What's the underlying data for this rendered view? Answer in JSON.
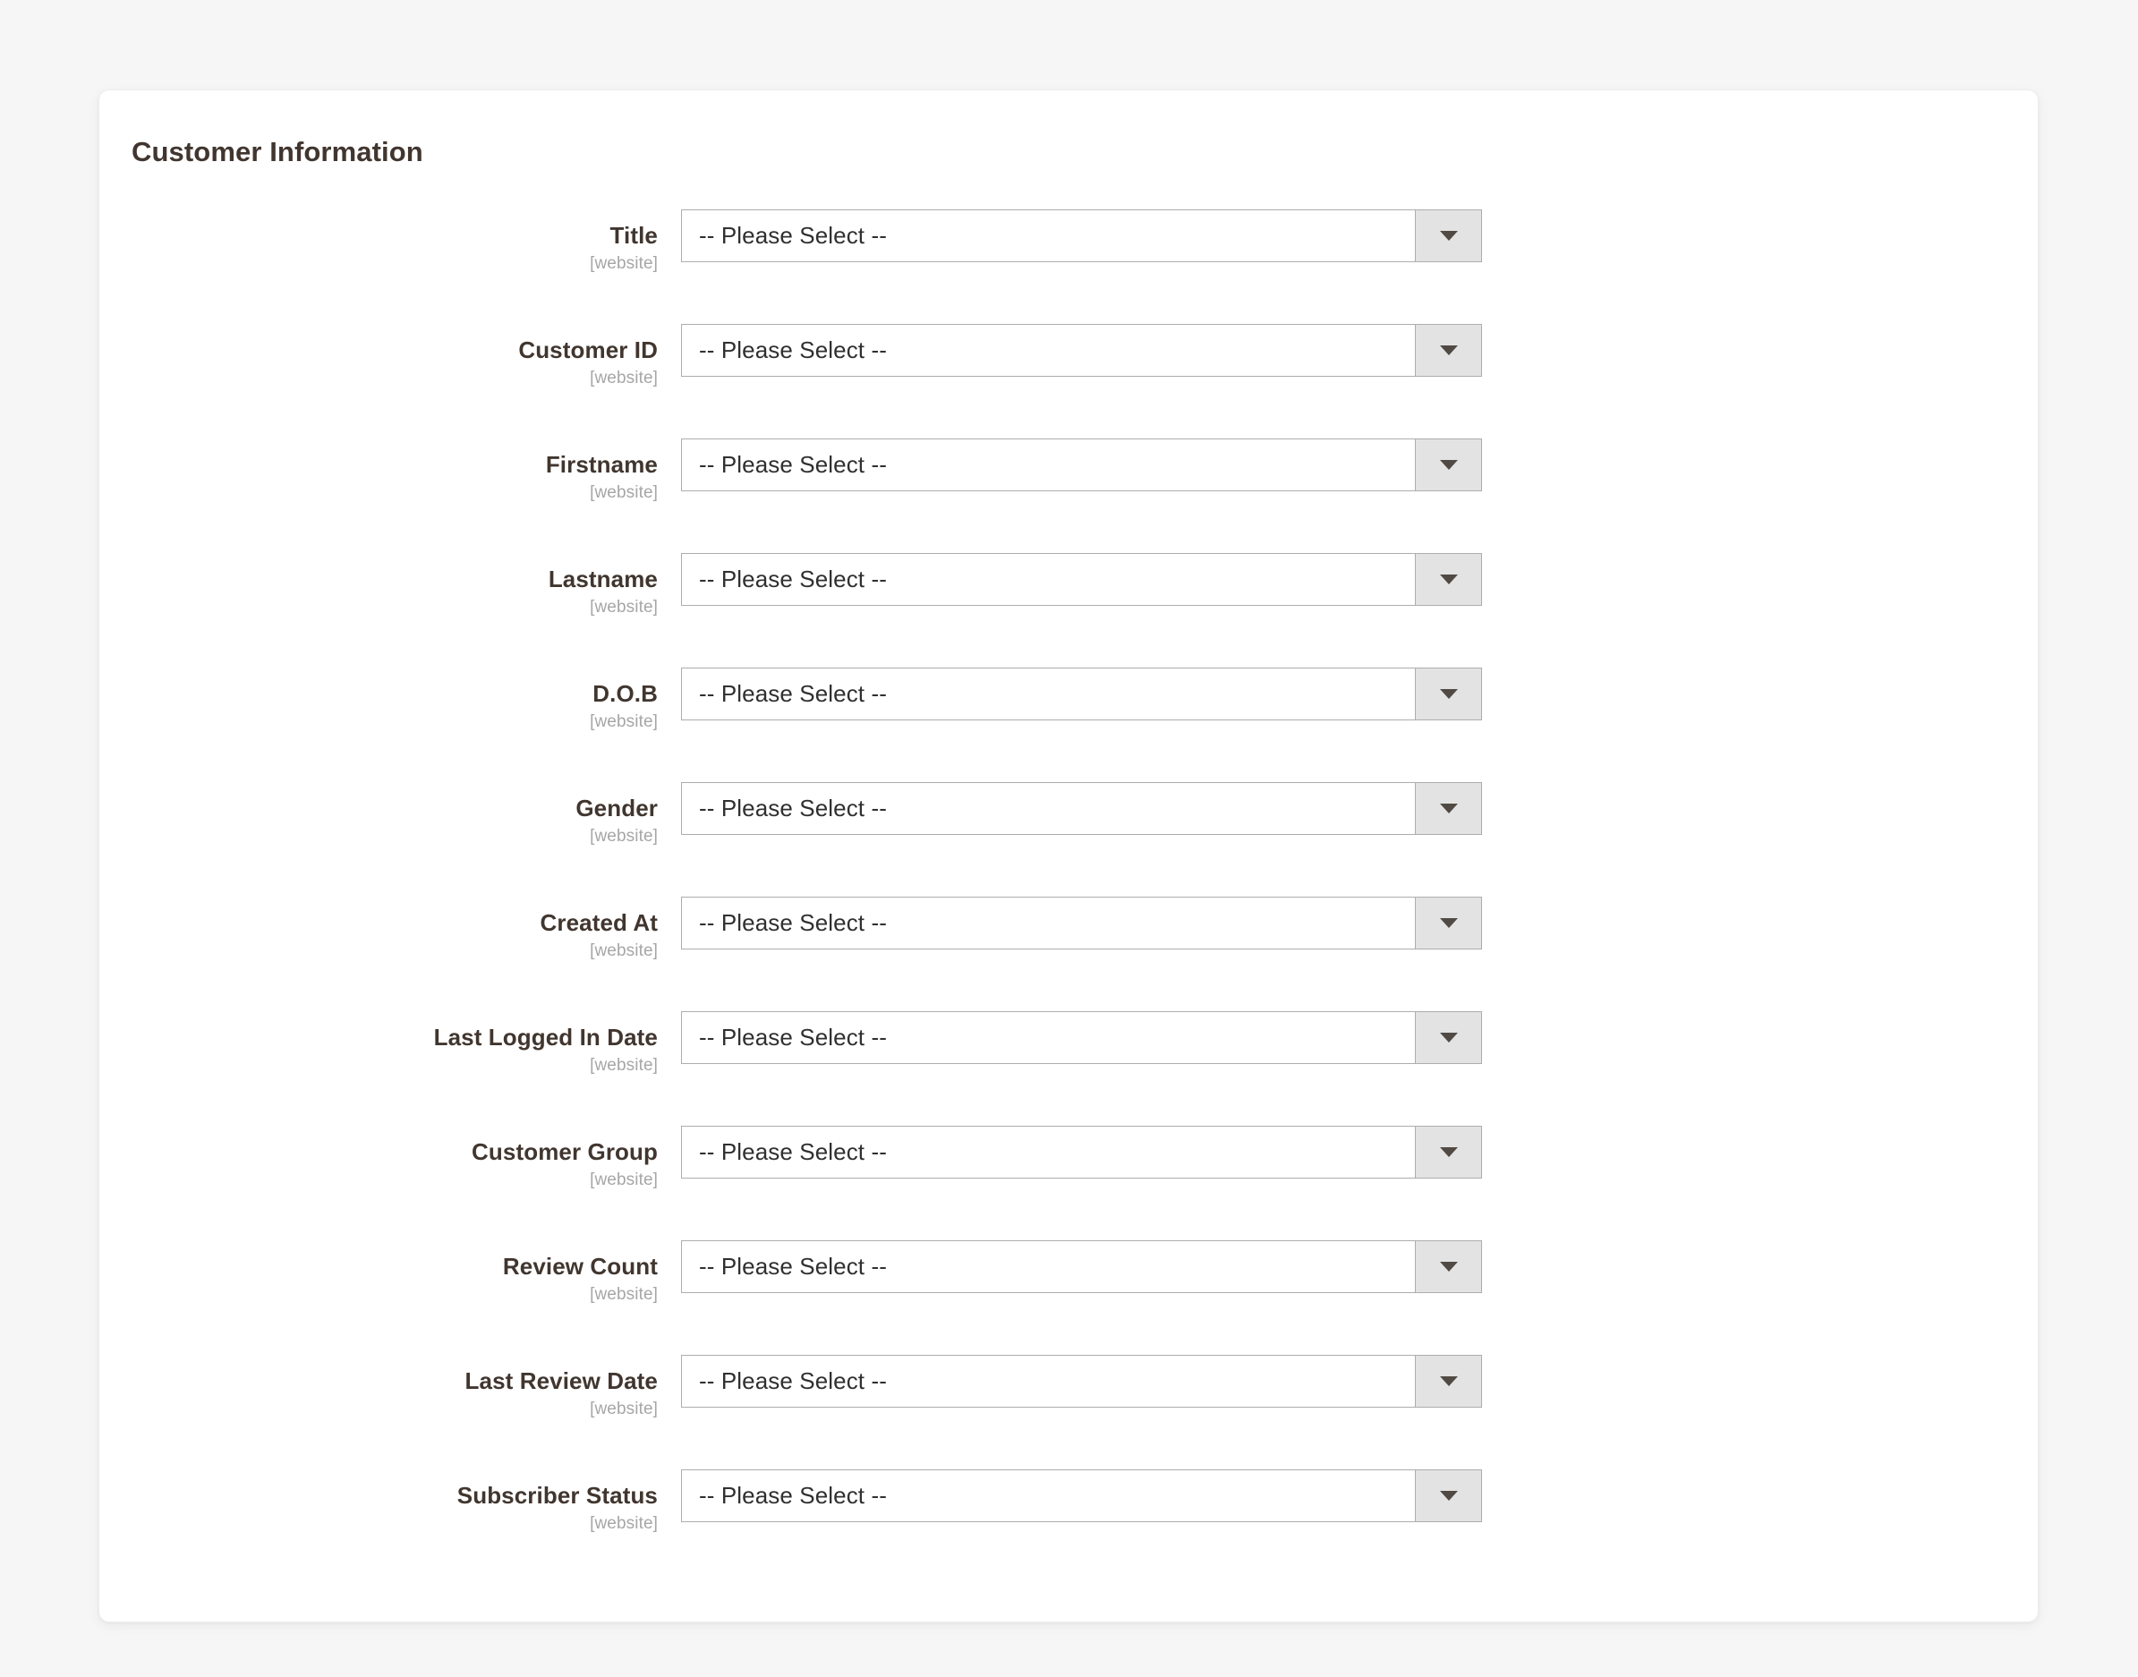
{
  "panel": {
    "title": "Customer Information",
    "scope_note": "[website]",
    "placeholder_option": "-- Please Select --",
    "fields": [
      {
        "label": "Title",
        "scope": "[website]",
        "value": "-- Please Select --"
      },
      {
        "label": "Customer ID",
        "scope": "[website]",
        "value": "-- Please Select --"
      },
      {
        "label": "Firstname",
        "scope": "[website]",
        "value": "-- Please Select --"
      },
      {
        "label": "Lastname",
        "scope": "[website]",
        "value": "-- Please Select --"
      },
      {
        "label": "D.O.B",
        "scope": "[website]",
        "value": "-- Please Select --"
      },
      {
        "label": "Gender",
        "scope": "[website]",
        "value": "-- Please Select --"
      },
      {
        "label": "Created At",
        "scope": "[website]",
        "value": "-- Please Select --"
      },
      {
        "label": "Last Logged In Date",
        "scope": "[website]",
        "value": "-- Please Select --"
      },
      {
        "label": "Customer Group",
        "scope": "[website]",
        "value": "-- Please Select --"
      },
      {
        "label": "Review Count",
        "scope": "[website]",
        "value": "-- Please Select --"
      },
      {
        "label": "Last Review Date",
        "scope": "[website]",
        "value": "-- Please Select --"
      },
      {
        "label": "Subscriber Status",
        "scope": "[website]",
        "value": "-- Please Select --"
      }
    ]
  },
  "icons": {
    "dropdown_caret": "chevron-down-icon"
  },
  "colors": {
    "page_background": "#f6f6f6",
    "panel_background": "#ffffff",
    "label_text": "#41362f",
    "scope_text": "#a6a6a6",
    "select_border": "#adadad",
    "select_button_background": "#e3e3e3",
    "caret": "#514a44"
  }
}
